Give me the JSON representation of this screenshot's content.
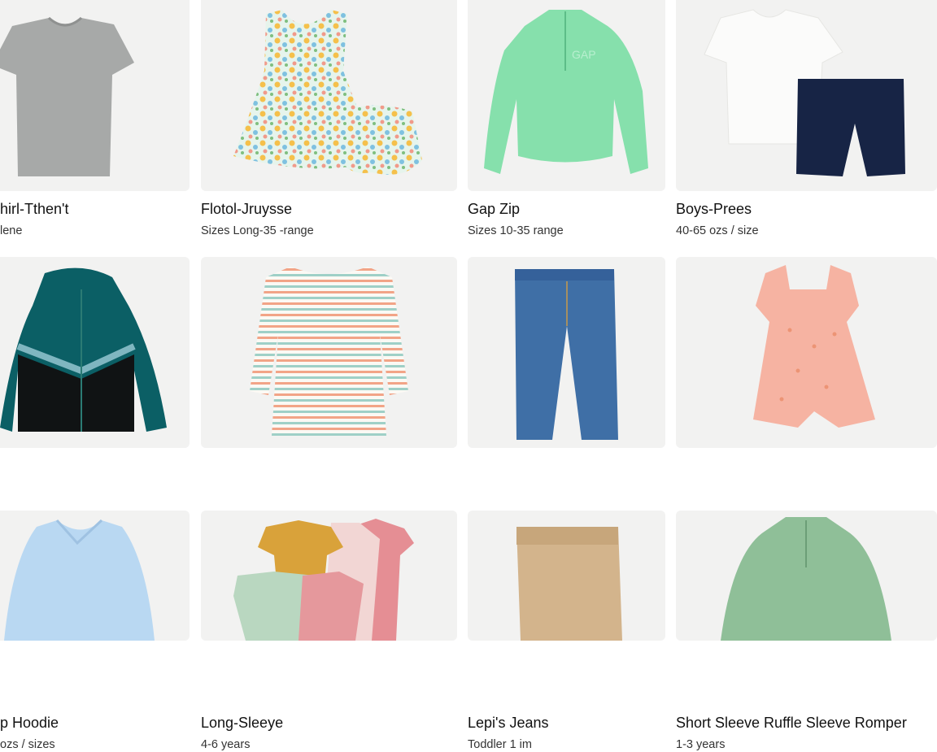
{
  "products": [
    {
      "title": "hirl-Tthen't",
      "meta": "lene"
    },
    {
      "title": "Flotol-Jruysse",
      "meta": "Sizes  Long-35 -range"
    },
    {
      "title": "Gap Zip",
      "meta": "Sizes 10-35 range",
      "print": "GAP"
    },
    {
      "title": "Boys-Prees",
      "meta": "40-65 ozs  / size"
    },
    {
      "title": "p Hoodie",
      "meta": "ozs / sizes"
    },
    {
      "title": "Long-Sleeye",
      "meta": "4-6 years"
    },
    {
      "title": "Lepi's Jeans",
      "meta": "Toddler  1 im"
    },
    {
      "title": "Short Sleeve Ruffle Sleeve Romper",
      "meta": "1-3 years"
    },
    {
      "title": "",
      "meta": ""
    },
    {
      "title": "",
      "meta": ""
    },
    {
      "title": "",
      "meta": ""
    },
    {
      "title": "",
      "meta": ""
    }
  ],
  "colors": {
    "card_bg": "#f2f2f1",
    "gray_tee": "#a7a9a8",
    "mint_zip": "#86e0ac",
    "teal_hoodie": "#0b5f65",
    "denim": "#3f6fa6",
    "peach_romper": "#f6b3a2",
    "light_blue_shirt": "#b9d8f2",
    "khaki": "#d3b48c",
    "sage": "#8fbf98"
  }
}
